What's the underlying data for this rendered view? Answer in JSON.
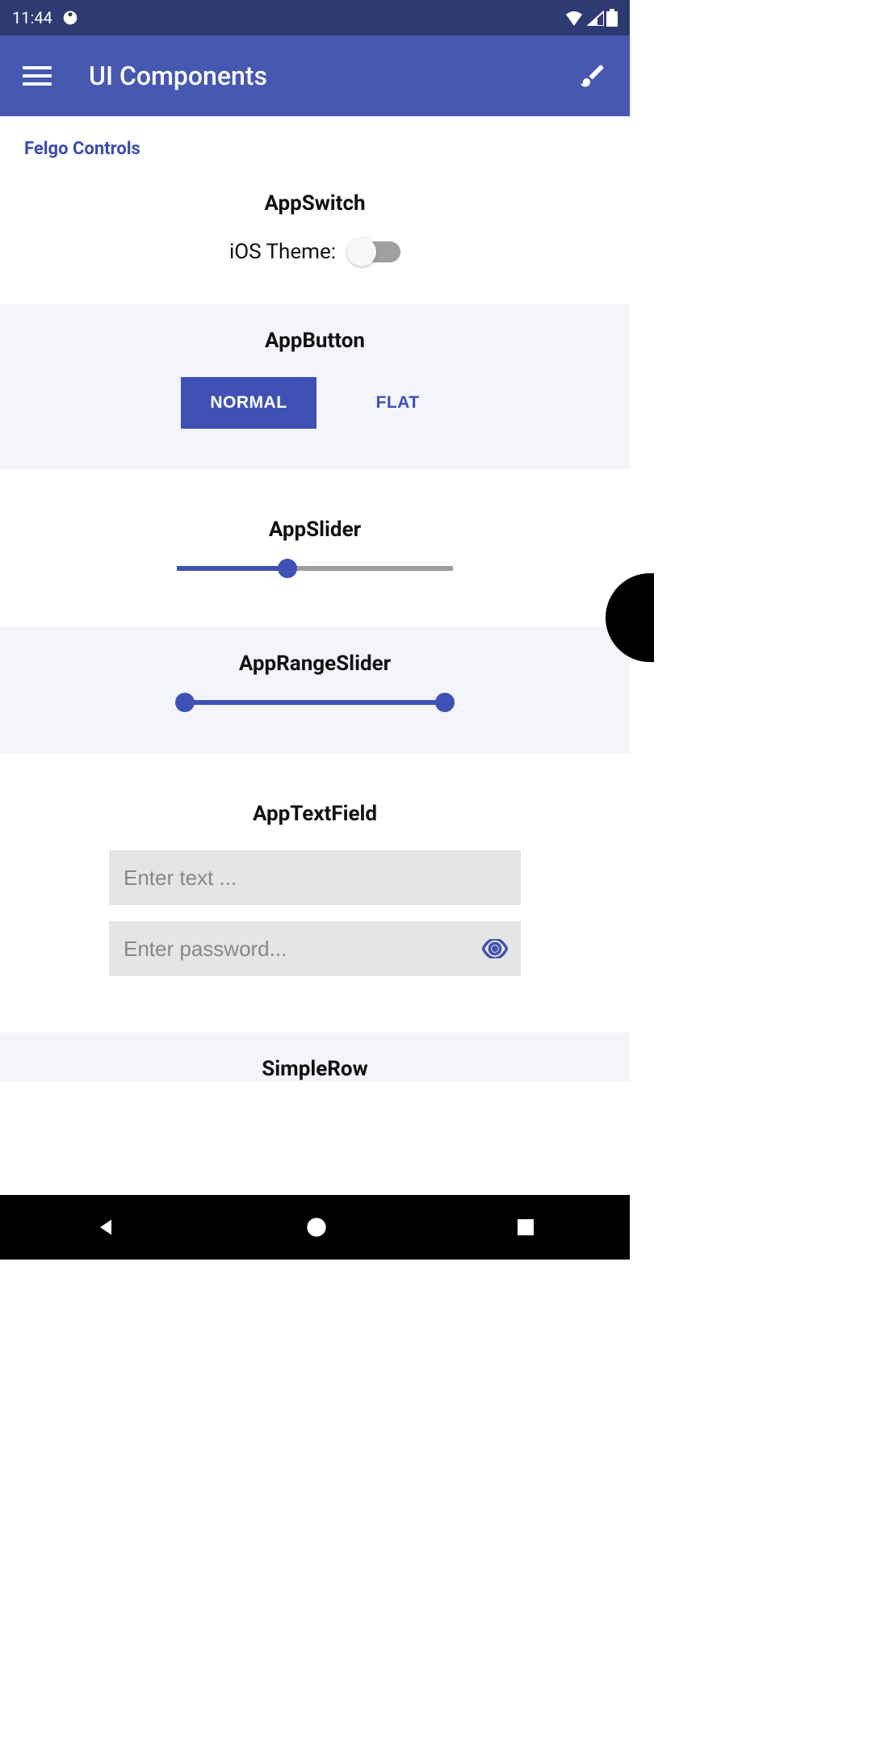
{
  "statusBar": {
    "time": "11:44"
  },
  "appBar": {
    "title": "UI Components"
  },
  "sectionLabel": "Felgo Controls",
  "cards": {
    "appSwitch": {
      "title": "AppSwitch",
      "label": "iOS Theme:"
    },
    "appButton": {
      "title": "AppButton",
      "normal": "NORMAL",
      "flat": "FLAT"
    },
    "appSlider": {
      "title": "AppSlider"
    },
    "appRangeSlider": {
      "title": "AppRangeSlider"
    },
    "appTextField": {
      "title": "AppTextField",
      "placeholder1": "Enter text ...",
      "placeholder2": "Enter password..."
    },
    "simpleRow": {
      "title": "SimpleRow"
    }
  }
}
